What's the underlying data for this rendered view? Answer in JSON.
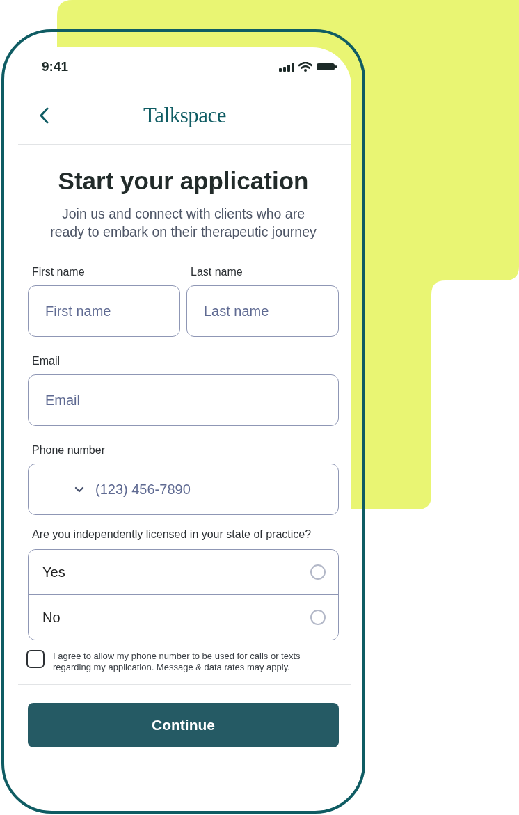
{
  "status_bar": {
    "time": "9:41"
  },
  "header": {
    "title": "Talkspace"
  },
  "heading": "Start your application",
  "subtitle": "Join us and connect with clients who are ready to embark on their therapeutic journey",
  "name_fields": [
    {
      "label": "First name",
      "placeholder": "First name"
    },
    {
      "label": "Last name",
      "placeholder": "Last name"
    }
  ],
  "email_field": {
    "label": "Email",
    "placeholder": "Email"
  },
  "phone_field": {
    "label": "Phone number",
    "placeholder": "(123) 456-7890"
  },
  "license_question": {
    "label": "Are you independently licensed in your state of practice?",
    "options": [
      {
        "label": "Yes",
        "selected": false
      },
      {
        "label": "No",
        "selected": false
      }
    ]
  },
  "consent": {
    "checked": false,
    "text": "I agree to allow my phone number to be used for calls or texts regarding my application. Message & data rates may apply."
  },
  "continue_button": "Continue"
}
